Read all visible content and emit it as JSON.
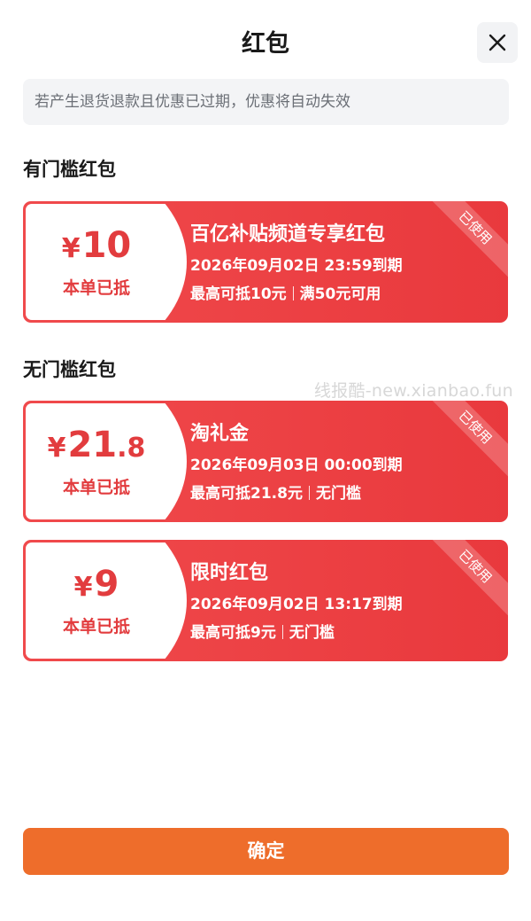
{
  "header": {
    "title": "红包",
    "close_icon": "close-icon"
  },
  "notice": "若产生退货退款且优惠已过期，优惠将自动失效",
  "watermark": "线报酷-new.xianbao.fun",
  "sections": [
    {
      "title": "有门槛红包",
      "coupons": [
        {
          "currency": "¥",
          "amount_int": "10",
          "amount_dec": "",
          "use_label": "本单已抵",
          "name": "百亿补贴频道专享红包",
          "expire": "2026年09月02日  23:59到期",
          "rule_max": "最高可抵10元",
          "rule_cond": "满50元可用",
          "status": "已使用"
        }
      ]
    },
    {
      "title": "无门槛红包",
      "coupons": [
        {
          "currency": "¥",
          "amount_int": "21",
          "amount_dec": ".8",
          "use_label": "本单已抵",
          "name": "淘礼金",
          "expire": "2026年09月03日  00:00到期",
          "rule_max": "最高可抵21.8元",
          "rule_cond": "无门槛",
          "status": "已使用"
        },
        {
          "currency": "¥",
          "amount_int": "9",
          "amount_dec": "",
          "use_label": "本单已抵",
          "name": "限时红包",
          "expire": "2026年09月02日  13:17到期",
          "rule_max": "最高可抵9元",
          "rule_cond": "无门槛",
          "status": "已使用"
        }
      ]
    }
  ],
  "confirm_label": "确定",
  "colors": {
    "coupon_red": "#eb3f42",
    "amount_red": "#e23c3e",
    "confirm_orange": "#ee6d2b"
  }
}
